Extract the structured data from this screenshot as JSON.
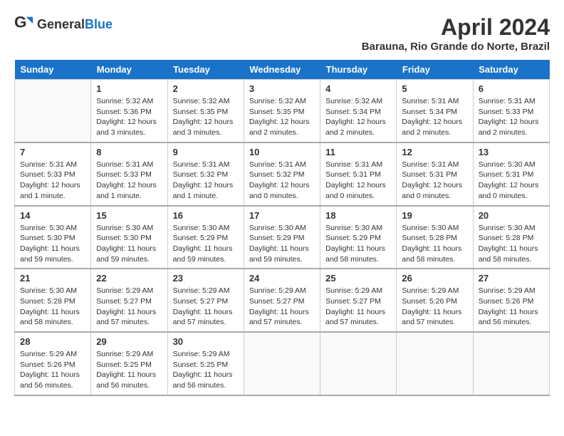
{
  "header": {
    "logo_general": "General",
    "logo_blue": "Blue",
    "month_year": "April 2024",
    "location": "Barauna, Rio Grande do Norte, Brazil"
  },
  "weekdays": [
    "Sunday",
    "Monday",
    "Tuesday",
    "Wednesday",
    "Thursday",
    "Friday",
    "Saturday"
  ],
  "weeks": [
    [
      {
        "day": "",
        "info": ""
      },
      {
        "day": "1",
        "info": "Sunrise: 5:32 AM\nSunset: 5:36 PM\nDaylight: 12 hours\nand 3 minutes."
      },
      {
        "day": "2",
        "info": "Sunrise: 5:32 AM\nSunset: 5:35 PM\nDaylight: 12 hours\nand 3 minutes."
      },
      {
        "day": "3",
        "info": "Sunrise: 5:32 AM\nSunset: 5:35 PM\nDaylight: 12 hours\nand 2 minutes."
      },
      {
        "day": "4",
        "info": "Sunrise: 5:32 AM\nSunset: 5:34 PM\nDaylight: 12 hours\nand 2 minutes."
      },
      {
        "day": "5",
        "info": "Sunrise: 5:31 AM\nSunset: 5:34 PM\nDaylight: 12 hours\nand 2 minutes."
      },
      {
        "day": "6",
        "info": "Sunrise: 5:31 AM\nSunset: 5:33 PM\nDaylight: 12 hours\nand 2 minutes."
      }
    ],
    [
      {
        "day": "7",
        "info": "Sunrise: 5:31 AM\nSunset: 5:33 PM\nDaylight: 12 hours\nand 1 minute."
      },
      {
        "day": "8",
        "info": "Sunrise: 5:31 AM\nSunset: 5:33 PM\nDaylight: 12 hours\nand 1 minute."
      },
      {
        "day": "9",
        "info": "Sunrise: 5:31 AM\nSunset: 5:32 PM\nDaylight: 12 hours\nand 1 minute."
      },
      {
        "day": "10",
        "info": "Sunrise: 5:31 AM\nSunset: 5:32 PM\nDaylight: 12 hours\nand 0 minutes."
      },
      {
        "day": "11",
        "info": "Sunrise: 5:31 AM\nSunset: 5:31 PM\nDaylight: 12 hours\nand 0 minutes."
      },
      {
        "day": "12",
        "info": "Sunrise: 5:31 AM\nSunset: 5:31 PM\nDaylight: 12 hours\nand 0 minutes."
      },
      {
        "day": "13",
        "info": "Sunrise: 5:30 AM\nSunset: 5:31 PM\nDaylight: 12 hours\nand 0 minutes."
      }
    ],
    [
      {
        "day": "14",
        "info": "Sunrise: 5:30 AM\nSunset: 5:30 PM\nDaylight: 11 hours\nand 59 minutes."
      },
      {
        "day": "15",
        "info": "Sunrise: 5:30 AM\nSunset: 5:30 PM\nDaylight: 11 hours\nand 59 minutes."
      },
      {
        "day": "16",
        "info": "Sunrise: 5:30 AM\nSunset: 5:29 PM\nDaylight: 11 hours\nand 59 minutes."
      },
      {
        "day": "17",
        "info": "Sunrise: 5:30 AM\nSunset: 5:29 PM\nDaylight: 11 hours\nand 59 minutes."
      },
      {
        "day": "18",
        "info": "Sunrise: 5:30 AM\nSunset: 5:29 PM\nDaylight: 11 hours\nand 58 minutes."
      },
      {
        "day": "19",
        "info": "Sunrise: 5:30 AM\nSunset: 5:28 PM\nDaylight: 11 hours\nand 58 minutes."
      },
      {
        "day": "20",
        "info": "Sunrise: 5:30 AM\nSunset: 5:28 PM\nDaylight: 11 hours\nand 58 minutes."
      }
    ],
    [
      {
        "day": "21",
        "info": "Sunrise: 5:30 AM\nSunset: 5:28 PM\nDaylight: 11 hours\nand 58 minutes."
      },
      {
        "day": "22",
        "info": "Sunrise: 5:29 AM\nSunset: 5:27 PM\nDaylight: 11 hours\nand 57 minutes."
      },
      {
        "day": "23",
        "info": "Sunrise: 5:29 AM\nSunset: 5:27 PM\nDaylight: 11 hours\nand 57 minutes."
      },
      {
        "day": "24",
        "info": "Sunrise: 5:29 AM\nSunset: 5:27 PM\nDaylight: 11 hours\nand 57 minutes."
      },
      {
        "day": "25",
        "info": "Sunrise: 5:29 AM\nSunset: 5:27 PM\nDaylight: 11 hours\nand 57 minutes."
      },
      {
        "day": "26",
        "info": "Sunrise: 5:29 AM\nSunset: 5:26 PM\nDaylight: 11 hours\nand 57 minutes."
      },
      {
        "day": "27",
        "info": "Sunrise: 5:29 AM\nSunset: 5:26 PM\nDaylight: 11 hours\nand 56 minutes."
      }
    ],
    [
      {
        "day": "28",
        "info": "Sunrise: 5:29 AM\nSunset: 5:26 PM\nDaylight: 11 hours\nand 56 minutes."
      },
      {
        "day": "29",
        "info": "Sunrise: 5:29 AM\nSunset: 5:25 PM\nDaylight: 11 hours\nand 56 minutes."
      },
      {
        "day": "30",
        "info": "Sunrise: 5:29 AM\nSunset: 5:25 PM\nDaylight: 11 hours\nand 56 minutes."
      },
      {
        "day": "",
        "info": ""
      },
      {
        "day": "",
        "info": ""
      },
      {
        "day": "",
        "info": ""
      },
      {
        "day": "",
        "info": ""
      }
    ]
  ]
}
